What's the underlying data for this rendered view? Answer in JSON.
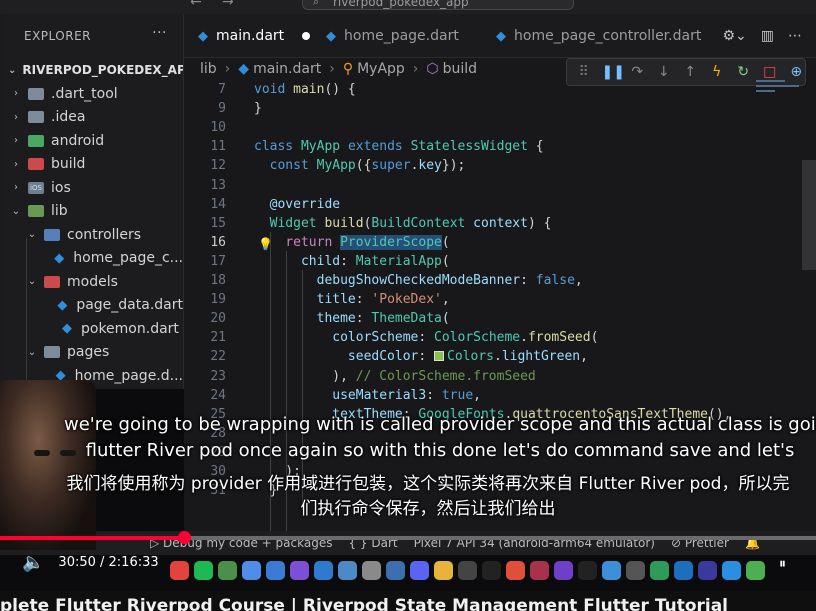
{
  "window": {
    "search_text": "riverpod_pokedex_app"
  },
  "sidebar": {
    "header": "EXPLORER",
    "more": "···",
    "project": "RIVERPOD_POKEDEX_APP",
    "items": [
      {
        "label": ".dart_tool",
        "icon": "folder-icon",
        "expanded": false,
        "depth": 1
      },
      {
        "label": ".idea",
        "icon": "folder-icon",
        "expanded": false,
        "depth": 1
      },
      {
        "label": "android",
        "icon": "android-folder-icon",
        "expanded": false,
        "depth": 1
      },
      {
        "label": "build",
        "icon": "build-folder-icon",
        "expanded": false,
        "depth": 1
      },
      {
        "label": "ios",
        "icon": "ios-folder-icon",
        "expanded": false,
        "depth": 1
      },
      {
        "label": "lib",
        "icon": "lib-folder-icon",
        "expanded": true,
        "depth": 1
      },
      {
        "label": "controllers",
        "icon": "controllers-folder-icon",
        "expanded": true,
        "depth": 2
      },
      {
        "label": "home_page_c...",
        "icon": "dart-file-icon",
        "depth": 3
      },
      {
        "label": "models",
        "icon": "models-folder-icon",
        "expanded": true,
        "depth": 2
      },
      {
        "label": "page_data.dart",
        "icon": "dart-file-icon",
        "depth": 3
      },
      {
        "label": "pokemon.dart",
        "icon": "dart-file-icon",
        "depth": 3
      },
      {
        "label": "pages",
        "icon": "pages-folder-icon",
        "expanded": true,
        "depth": 2
      },
      {
        "label": "home_page.d...",
        "icon": "dart-file-icon",
        "depth": 3
      },
      {
        "label": "main.dart",
        "icon": "dart-file-icon",
        "depth": 2
      }
    ]
  },
  "tabs": [
    {
      "label": "main.dart",
      "active": true,
      "dirty": true
    },
    {
      "label": "home_page.dart",
      "active": false
    },
    {
      "label": "home_page_controller.dart",
      "active": false
    }
  ],
  "breadcrumb": [
    "lib",
    "main.dart",
    "MyApp",
    "build"
  ],
  "code": {
    "lines": [
      {
        "n": "7",
        "html": "<span class='kw'>void</span> <span class='fn'>main</span>() {"
      },
      {
        "n": "9",
        "html": "}"
      },
      {
        "n": "10",
        "html": ""
      },
      {
        "n": "11",
        "html": "<span class='kw'>class</span> <span class='cls'>MyApp</span> <span class='kw'>extends</span> <span class='cls'>StatelessWidget</span> {"
      },
      {
        "n": "12",
        "html": "  <span class='kw'>const</span> <span class='cls'>MyApp</span>({<span class='kw'>super</span>.<span class='prop'>key</span>});"
      },
      {
        "n": "13",
        "html": ""
      },
      {
        "n": "14",
        "html": "  <span class='annot'>@override</span>"
      },
      {
        "n": "15",
        "html": "  <span class='cls'>Widget</span> <span class='fn'>build</span>(<span class='cls'>BuildContext</span> <span class='prop'>context</span>) {"
      },
      {
        "n": "16",
        "html": "    <span class='kc'>return</span> <span class='cls hl'>ProviderScope</span>(",
        "current": true,
        "bulb": true
      },
      {
        "n": "17",
        "html": "      <span class='prop'>child</span>: <span class='cls'>MaterialApp</span>("
      },
      {
        "n": "18",
        "html": "        <span class='prop'>debugShowCheckedModeBanner</span>: <span class='kw'>false</span>,"
      },
      {
        "n": "19",
        "html": "        <span class='prop'>title</span>: <span class='str'>'PokeDex'</span>,"
      },
      {
        "n": "20",
        "html": "        <span class='prop'>theme</span>: <span class='cls'>ThemeData</span>("
      },
      {
        "n": "21",
        "html": "          <span class='prop'>colorScheme</span>: <span class='cls'>ColorScheme</span>.<span class='fn'>fromSeed</span>("
      },
      {
        "n": "22",
        "html": "            <span class='prop'>seedColor</span>: <span class='swatch'></span><span class='cls'>Colors</span>.<span class='prop'>lightGreen</span>,"
      },
      {
        "n": "23",
        "html": "          ), <span class='cm'>// ColorScheme.fromSeed</span>"
      },
      {
        "n": "24",
        "html": "          <span class='prop'>useMaterial3</span>: <span class='kw'>true</span>,"
      },
      {
        "n": "25",
        "html": "          <span class='prop'>textTheme</span>: <span class='cls'>GoogleFonts</span>.<span class='fn'>quattrocentoSansTextTheme</span>(),"
      },
      {
        "n": "28",
        "html": ""
      },
      {
        "n": "29",
        "html": ""
      },
      {
        "n": "30",
        "html": "    );"
      },
      {
        "n": "31",
        "html": "  }"
      }
    ]
  },
  "statusbar": {
    "debug": "Debug my code + packages",
    "language": "{ }  Dart",
    "device": "Pixel 7 API 34 (android-arm64 emulator)",
    "formatter": "⊘ Prettier"
  },
  "video": {
    "subtitle_en_1": "we're going to be wrapping with is called provider scope and this actual class is going",
    "subtitle_en_2": "flutter River pod once again so with this done let's do command save and let's",
    "subtitle_zh_1": "我们将使用称为 provider 作用域进行包装，这个实际类将再次来自 Flutter River pod，所以完",
    "subtitle_zh_2": "们执行命令保存，然后让我们给出",
    "time": "30:50 / 2:16:33",
    "progress": 0.2255,
    "title": "plete Flutter Riverpod Course | Riverpod State Management Flutter Tutorial"
  }
}
